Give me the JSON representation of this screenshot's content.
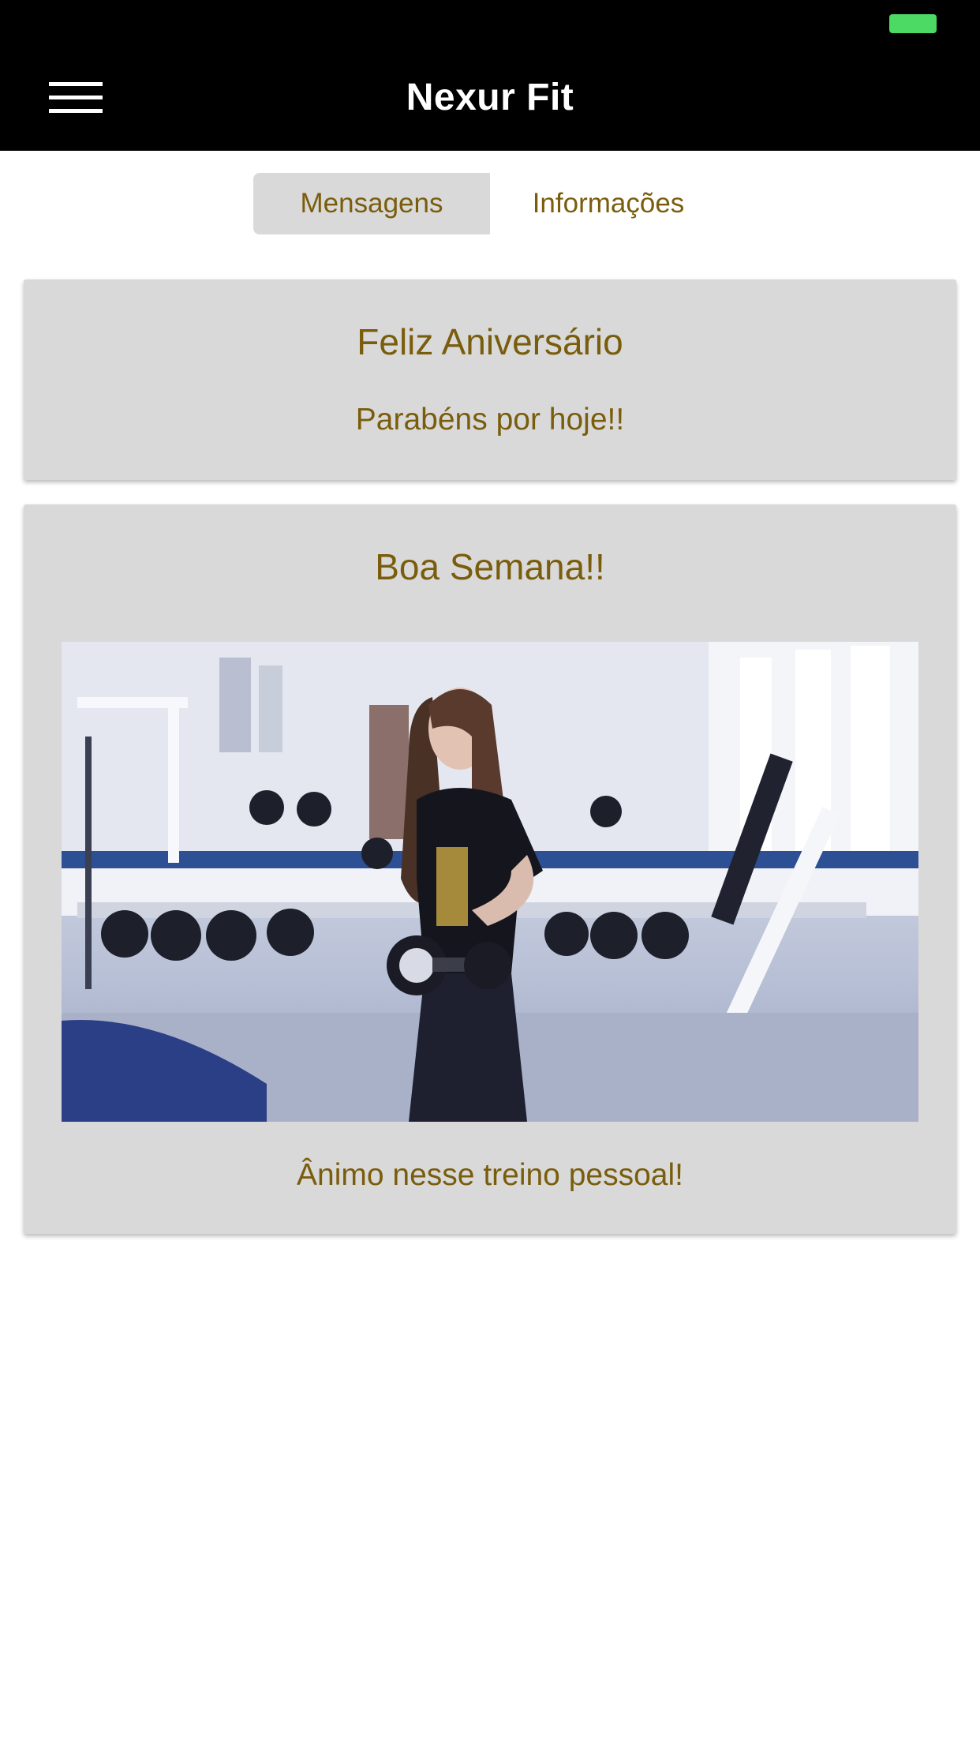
{
  "app": {
    "title": "Nexur Fit"
  },
  "colors": {
    "accent": "#7a5d0c",
    "navbar": "#000000",
    "card_bg": "#d9d9d9",
    "battery": "#4cd964"
  },
  "icons": {
    "menu": "hamburger-menu-icon",
    "battery": "battery-icon"
  },
  "tabs": {
    "messages_label": "Mensagens",
    "info_label": "Informações",
    "selected": "Mensagens"
  },
  "messages": [
    {
      "title": "Feliz Aniversário",
      "body": "Parabéns por hoje!!"
    },
    {
      "title": "Boa Semana!!",
      "image": "gym-woman-dumbbell-photo",
      "body": "Ânimo nesse treino pessoal!"
    }
  ]
}
